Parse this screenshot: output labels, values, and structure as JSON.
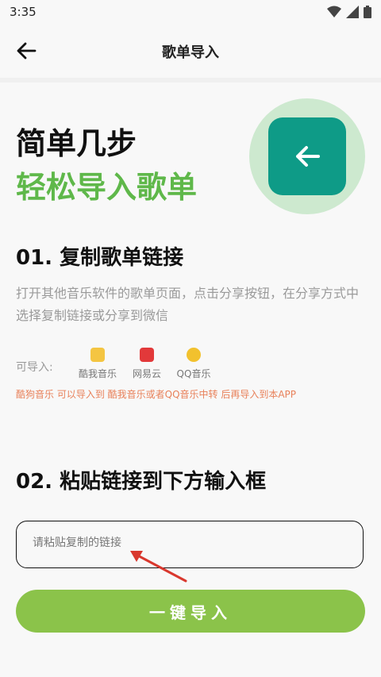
{
  "status_bar": {
    "time": "3:35"
  },
  "app_bar": {
    "title": "歌单导入"
  },
  "hero": {
    "line1": "简单几步",
    "line2": "轻松导入歌单",
    "accent": "#5fb84a",
    "tile_color": "#0e9b87"
  },
  "step1": {
    "heading": "01. 复制歌单链接",
    "description": "打开其他音乐软件的歌单页面，点击分享按钮，在分享方式中选择复制链接或分享到微信",
    "import_label": "可导入:",
    "sources": [
      {
        "name": "酷我音乐",
        "icon": "kuwo-icon"
      },
      {
        "name": "网易云",
        "icon": "netease-icon"
      },
      {
        "name": "QQ音乐",
        "icon": "qqmusic-icon"
      }
    ],
    "note": "酷狗音乐 可以导入到 酷我音乐或者QQ音乐中转 后再导入到本APP"
  },
  "step2": {
    "heading": "02. 粘贴链接到下方输入框",
    "input_placeholder": "请粘贴复制的链接"
  },
  "import_button": {
    "label": "一键导入",
    "color": "#8bc34a"
  }
}
